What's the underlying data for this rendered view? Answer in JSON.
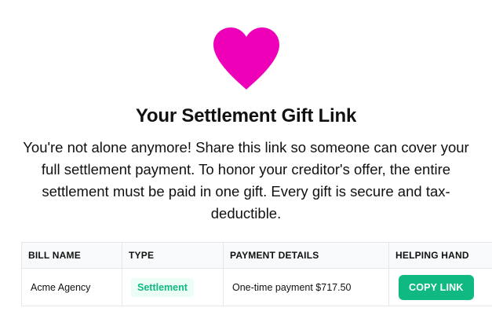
{
  "hero": {
    "icon": "heart-icon",
    "icon_color": "#ee00b9",
    "title": "Your Settlement Gift Link",
    "message": "You're not alone anymore! Share this link so someone can cover your full settlement payment. To honor your creditor's offer, the entire settlement must be paid in one gift. Every gift is secure and tax-deductible."
  },
  "table": {
    "headers": {
      "bill_name": "BILL NAME",
      "type": "TYPE",
      "payment_details": "PAYMENT DETAILS",
      "helping_hand": "HELPING HAND"
    },
    "rows": [
      {
        "bill_name": "Acme Agency",
        "type": "Settlement",
        "payment_details": "One-time payment $717.50",
        "action": "COPY LINK"
      }
    ]
  },
  "colors": {
    "accent": "#10b981",
    "badge_bg": "#ecfdf5",
    "header_bg": "#f8fafc",
    "border": "#e5e7eb"
  }
}
